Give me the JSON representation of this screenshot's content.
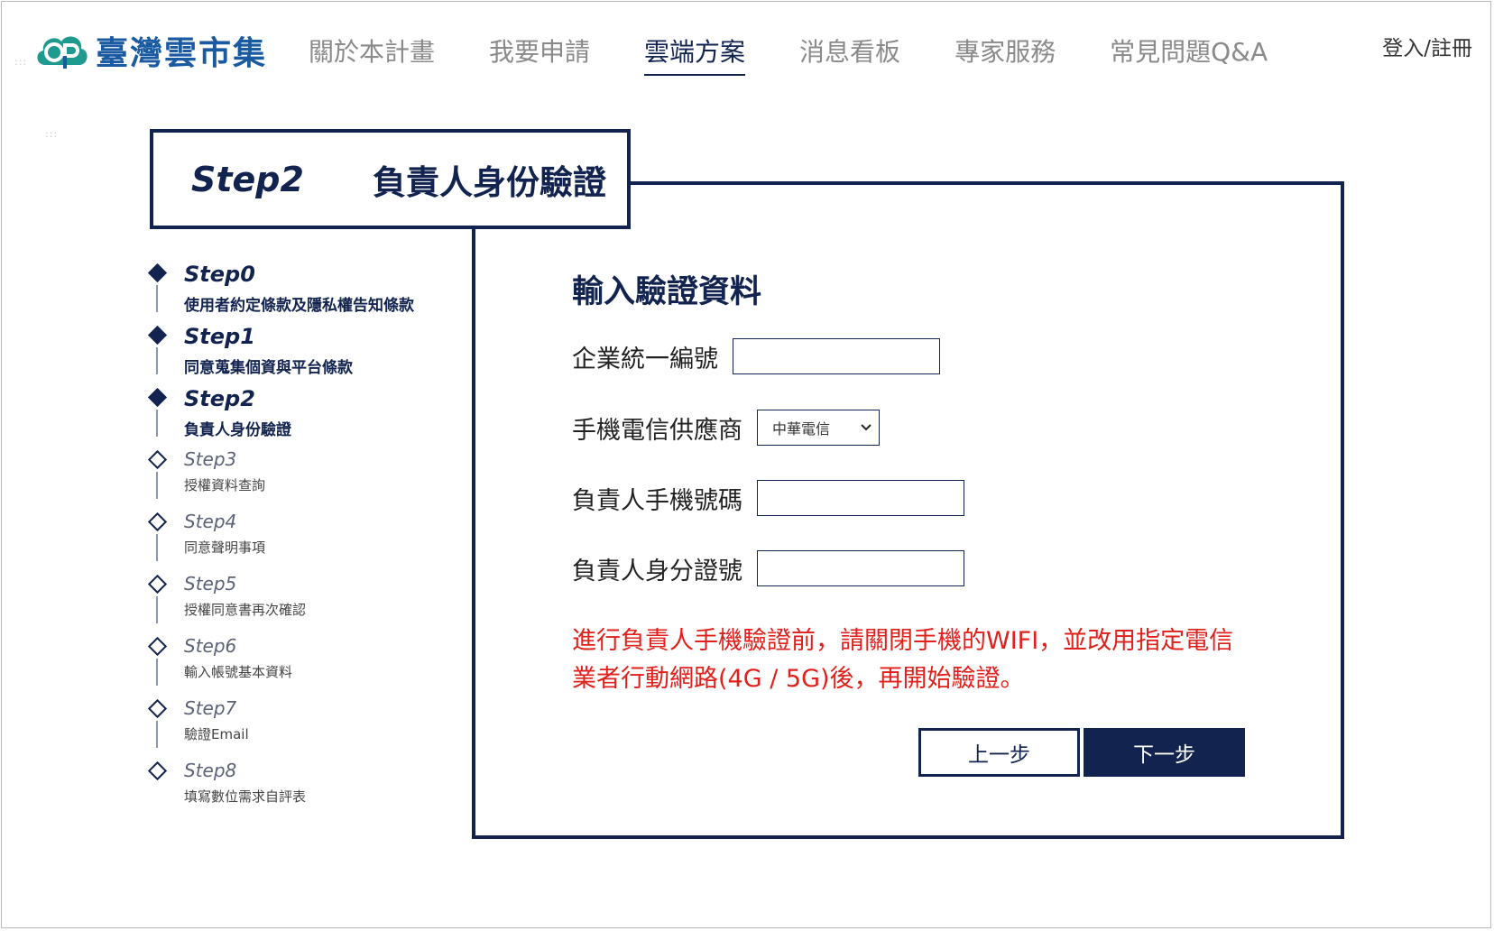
{
  "header": {
    "brand": "臺灣雲市集",
    "nav": [
      "關於本計畫",
      "我要申請",
      "雲端方案",
      "消息看板",
      "專家服務",
      "常見問題Q&A"
    ],
    "active_index": 2,
    "login": "登入/註冊"
  },
  "title": {
    "step": "Step2",
    "text": "負責人身份驗證"
  },
  "steps": [
    {
      "num": "Step0",
      "desc": "使用者約定條款及隱私權告知條款",
      "done": true
    },
    {
      "num": "Step1",
      "desc": "同意蒐集個資與平台條款",
      "done": true
    },
    {
      "num": "Step2",
      "desc": "負責人身份驗證",
      "done": true
    },
    {
      "num": "Step3",
      "desc": "授權資料查詢",
      "done": false
    },
    {
      "num": "Step4",
      "desc": "同意聲明事項",
      "done": false
    },
    {
      "num": "Step5",
      "desc": "授權同意書再次確認",
      "done": false
    },
    {
      "num": "Step6",
      "desc": "輸入帳號基本資料",
      "done": false
    },
    {
      "num": "Step7",
      "desc": "驗證Email",
      "done": false
    },
    {
      "num": "Step8",
      "desc": "填寫數位需求自評表",
      "done": false
    }
  ],
  "form": {
    "heading": "輸入驗證資料",
    "company_id_label": "企業統一編號",
    "company_id_value": "",
    "carrier_label": "手機電信供應商",
    "carrier_value": "中華電信",
    "phone_label": "負責人手機號碼",
    "phone_value": "",
    "id_label": "負責人身分證號",
    "id_value": "",
    "warning": "進行負責人手機驗證前，請關閉手機的WIFI，並改用指定電信業者行動網路(4G / 5G)後，再開始驗證。",
    "prev_label": "上一步",
    "next_label": "下一步"
  },
  "colors": {
    "primary": "#12234f",
    "warning": "#e0201b",
    "brand": "#1a5aa0"
  }
}
